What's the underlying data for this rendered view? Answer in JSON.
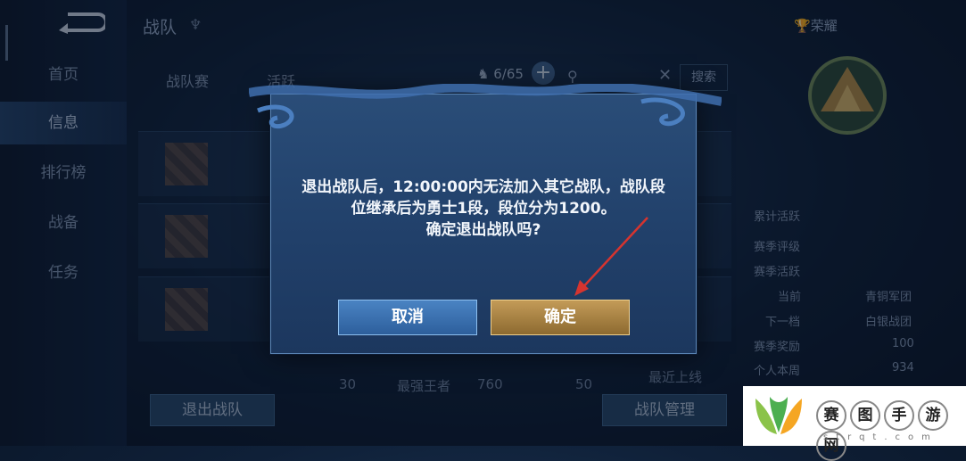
{
  "header": {
    "title": "战队",
    "glory_label": "荣耀"
  },
  "nav": {
    "items": [
      "首页",
      "信息",
      "排行榜",
      "战备",
      "任务"
    ],
    "active_index": 1
  },
  "tabs": [
    "战队赛",
    "活跃"
  ],
  "member_count": "6/65",
  "search": {
    "button_label": "搜索"
  },
  "bottom_row": {
    "count": "30",
    "title": "最强王者",
    "score": "760",
    "score2": "50",
    "last_online": "最近上线"
  },
  "buttons": {
    "leave_team": "退出战队",
    "manage_team": "战队管理"
  },
  "stats": {
    "season_rating": "赛季评级",
    "season_active": "赛季活跃",
    "current": "当前",
    "current_value": "青铜军团",
    "next": "下一档",
    "next_value": "白银战团",
    "season_reward": "赛季奖励",
    "season_reward_value": "100",
    "personal": "个人本周",
    "personal_value": "934",
    "total_active": "累计活跃"
  },
  "dialog": {
    "line1": "退出战队后，12:00:00内无法加入其它战队，战队段",
    "line2": "位继承后为勇士1段，段位分为1200。",
    "line3": "确定退出战队吗?",
    "cancel_label": "取消",
    "confirm_label": "确定"
  },
  "watermark": {
    "chars": [
      "赛",
      "图",
      "手",
      "游",
      "网"
    ],
    "url": "strqt.com"
  },
  "colors": {
    "cancel": "#3b70ad",
    "confirm": "#b08a48",
    "arrow": "#d6342f"
  }
}
